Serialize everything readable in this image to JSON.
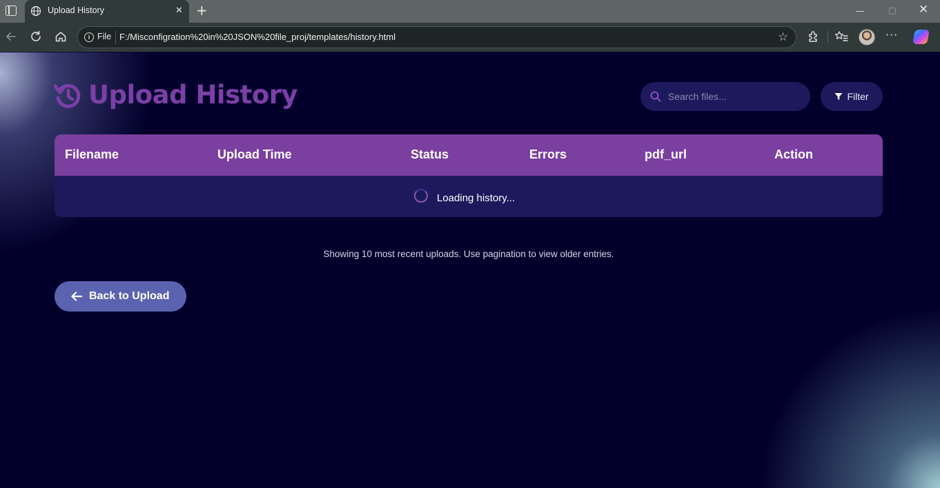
{
  "browser": {
    "tab_title": "Upload History",
    "address_label": "File",
    "url": "F:/Misconfigration%20in%20JSON%20file_proj/templates/history.html"
  },
  "header": {
    "title": "Upload History",
    "search_placeholder": "Search files...",
    "filter_label": "Filter"
  },
  "table": {
    "columns": [
      "Filename",
      "Upload Time",
      "Status",
      "Errors",
      "pdf_url",
      "Action"
    ],
    "loading_text": "Loading history..."
  },
  "footnote": "Showing 10 most recent uploads. Use pagination to view older entries.",
  "back_button": "Back to Upload",
  "colors": {
    "page_bg": "#02002b",
    "accent_purple": "#7b3fa0",
    "table_body": "#1c1a5c",
    "back_button": "#5b63b0"
  }
}
